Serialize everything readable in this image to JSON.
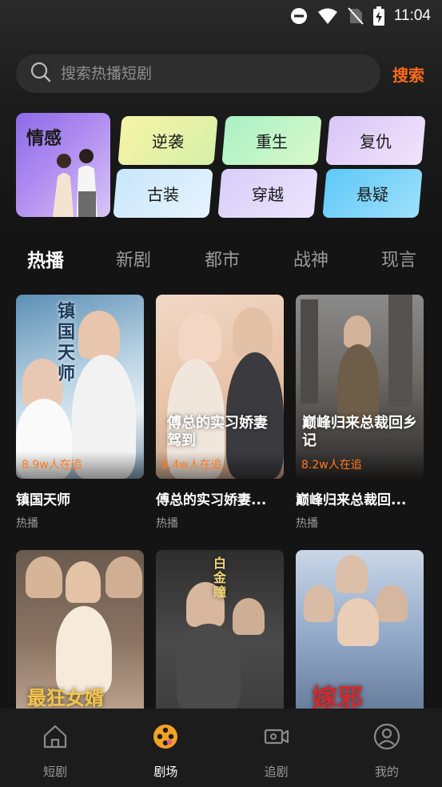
{
  "status_bar": {
    "time": "11:04",
    "icons": [
      "dnd-icon",
      "wifi-icon",
      "no-sim-icon",
      "battery-charging-icon"
    ]
  },
  "search": {
    "placeholder": "搜索热播短剧",
    "button_label": "搜索"
  },
  "categories": {
    "featured": {
      "label": "情感",
      "icon": "couple-illustration"
    },
    "tags": [
      {
        "label": "逆袭",
        "gradient": [
          "#f7f4a6",
          "#d6f0a8"
        ]
      },
      {
        "label": "重生",
        "gradient": [
          "#a9f1c6",
          "#d9f9c8"
        ]
      },
      {
        "label": "复仇",
        "gradient": [
          "#d7c6f7",
          "#f2e3fb"
        ]
      },
      {
        "label": "古装",
        "gradient": [
          "#c8e6fb",
          "#e6f3fd"
        ]
      },
      {
        "label": "穿越",
        "gradient": [
          "#d8cdfa",
          "#ece5fb"
        ]
      },
      {
        "label": "悬疑",
        "gradient": [
          "#5ec8f7",
          "#9ee0fb"
        ]
      }
    ]
  },
  "tabs": [
    {
      "label": "热播",
      "active": true
    },
    {
      "label": "新剧",
      "active": false
    },
    {
      "label": "都市",
      "active": false
    },
    {
      "label": "战神",
      "active": false
    },
    {
      "label": "现言",
      "active": false
    }
  ],
  "dramas": [
    {
      "title": "镇国天师",
      "tag": "热播",
      "watching": "8.9w人在追",
      "poster_art": "镇国天师"
    },
    {
      "title": "傅总的实习娇妻...",
      "tag": "热播",
      "watching": "8.4w人在追",
      "poster_art": "傅总的实习娇妻驾到"
    },
    {
      "title": "巅峰归来总裁回...",
      "tag": "热播",
      "watching": "8.2w人在追",
      "poster_art": "巅峰归来总裁回乡记"
    },
    {
      "title": "",
      "tag": "",
      "watching": "",
      "poster_art": "最狂女婿"
    },
    {
      "title": "",
      "tag": "",
      "watching": "",
      "poster_art": "白金瞳"
    },
    {
      "title": "",
      "tag": "",
      "watching": "",
      "poster_art": "嫁邪"
    }
  ],
  "bottom_nav": [
    {
      "label": "短剧",
      "icon": "home-icon",
      "active": false
    },
    {
      "label": "剧场",
      "icon": "film-reel-icon",
      "active": true
    },
    {
      "label": "追剧",
      "icon": "video-camera-icon",
      "active": false
    },
    {
      "label": "我的",
      "icon": "user-icon",
      "active": false
    }
  ],
  "colors": {
    "accent": "#ff6a1a",
    "background": "#141414",
    "watching_text": "#ff7a1f"
  }
}
